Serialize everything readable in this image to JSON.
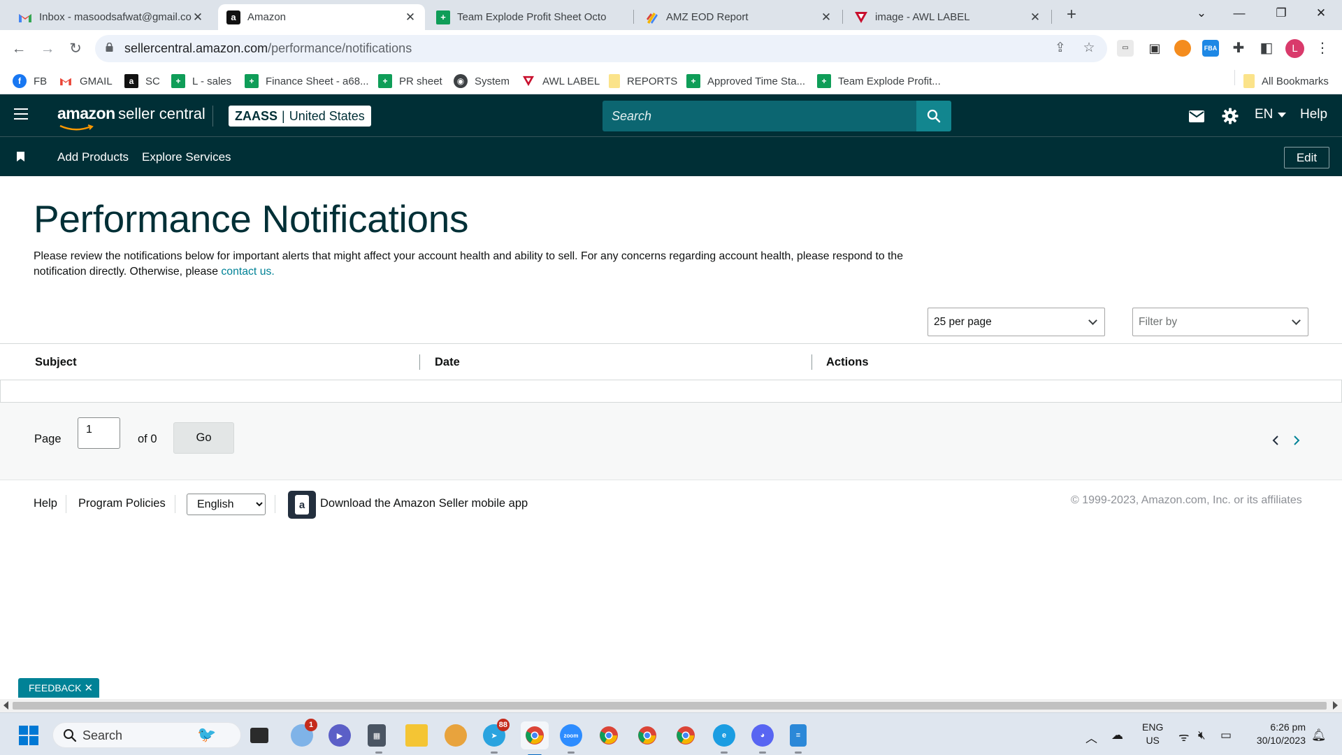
{
  "browser": {
    "tabs": [
      {
        "label": "Inbox - masoodsafwat@gmail.co",
        "active": false
      },
      {
        "label": "Amazon",
        "active": true
      },
      {
        "label": "Team Explode Profit Sheet Octo",
        "active": false
      },
      {
        "label": "AMZ EOD Report",
        "active": false
      },
      {
        "label": "image - AWL LABEL",
        "active": false
      }
    ],
    "url_host": "sellercentral.amazon.com",
    "url_path": "/performance/notifications",
    "profile_initial": "L",
    "bookmarks": [
      {
        "label": "FB",
        "icon": "facebook-icon"
      },
      {
        "label": "GMAIL",
        "icon": "gmail-icon"
      },
      {
        "label": "SC",
        "icon": "amazon-icon"
      },
      {
        "label": "L - sales",
        "icon": "sheets-icon"
      },
      {
        "label": "Finance Sheet - a68...",
        "icon": "sheets-icon"
      },
      {
        "label": "PR sheet",
        "icon": "sheets-icon"
      },
      {
        "label": "System",
        "icon": "globe-icon"
      },
      {
        "label": "AWL LABEL",
        "icon": "awl-icon"
      },
      {
        "label": "REPORTS",
        "icon": "folder-icon"
      },
      {
        "label": "Approved Time Sta...",
        "icon": "sheets-icon"
      },
      {
        "label": "Team Explode Profit...",
        "icon": "sheets-icon"
      }
    ],
    "all_bookmarks_label": "All Bookmarks"
  },
  "header": {
    "brand_amazon": "amazon",
    "brand_suffix": "seller central",
    "account_name": "ZAASS",
    "account_sep": "|",
    "account_region": "United States",
    "search_placeholder": "Search",
    "language": "EN",
    "help": "Help"
  },
  "subnav": {
    "links": [
      "Add Products",
      "Explore Services"
    ],
    "edit_label": "Edit"
  },
  "main": {
    "title": "Performance Notifications",
    "intro_text": "Please review the notifications below for important alerts that might affect your account health and ability to sell. For any concerns regarding account health, please respond to the notification directly. Otherwise, please ",
    "intro_link": "contact us.",
    "per_page": "25 per page",
    "filter_placeholder": "Filter by",
    "columns": [
      "Subject",
      "Date",
      "Actions"
    ],
    "rows": []
  },
  "pagination": {
    "page_label": "Page",
    "page_value": "1",
    "of_label": "of 0",
    "go_label": "Go"
  },
  "footer": {
    "help": "Help",
    "program_policies": "Program Policies",
    "language_selected": "English",
    "app_text": "Download the Amazon Seller mobile app",
    "copyright": "© 1999-2023, Amazon.com, Inc. or its affiliates"
  },
  "feedback": {
    "label": "FEEDBACK",
    "close": "✕"
  },
  "taskbar": {
    "search_label": "Search",
    "weather_badge": "1",
    "telegram_badge": "88",
    "lang_line1": "ENG",
    "lang_line2": "US",
    "time": "6:26 pm",
    "date": "30/10/2023"
  },
  "colors": {
    "header_bg": "#002f36",
    "search_bg": "#0c6671",
    "search_button": "#12868f",
    "link": "#008296",
    "title": "#002f36",
    "feedback_bg": "#008296"
  }
}
